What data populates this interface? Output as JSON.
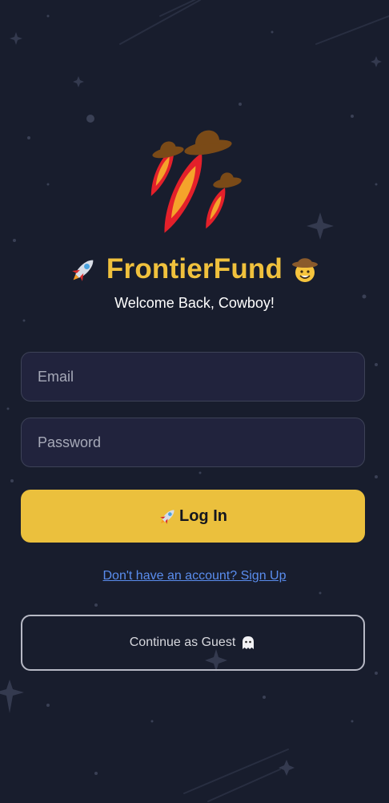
{
  "brand": {
    "title": "FrontierFund",
    "logo_icon": "rocket-cowboy-hats-logo",
    "title_left_icon": "rocket-icon",
    "title_right_icon": "cowboy-face-icon",
    "accent_color": "#f0c13d"
  },
  "subtitle": "Welcome Back, Cowboy!",
  "form": {
    "email_placeholder": "Email",
    "email_value": "",
    "password_placeholder": "Password",
    "password_value": "",
    "login_label": "Log In",
    "login_icon": "rocket-icon",
    "login_color": "#ebc03d"
  },
  "signup_link": "Don't have an account? Sign Up",
  "guest": {
    "label": "Continue as Guest",
    "icon": "ghost-icon"
  },
  "colors": {
    "background": "#181d2d",
    "input_background": "#21233d",
    "link": "#5a8dee"
  }
}
